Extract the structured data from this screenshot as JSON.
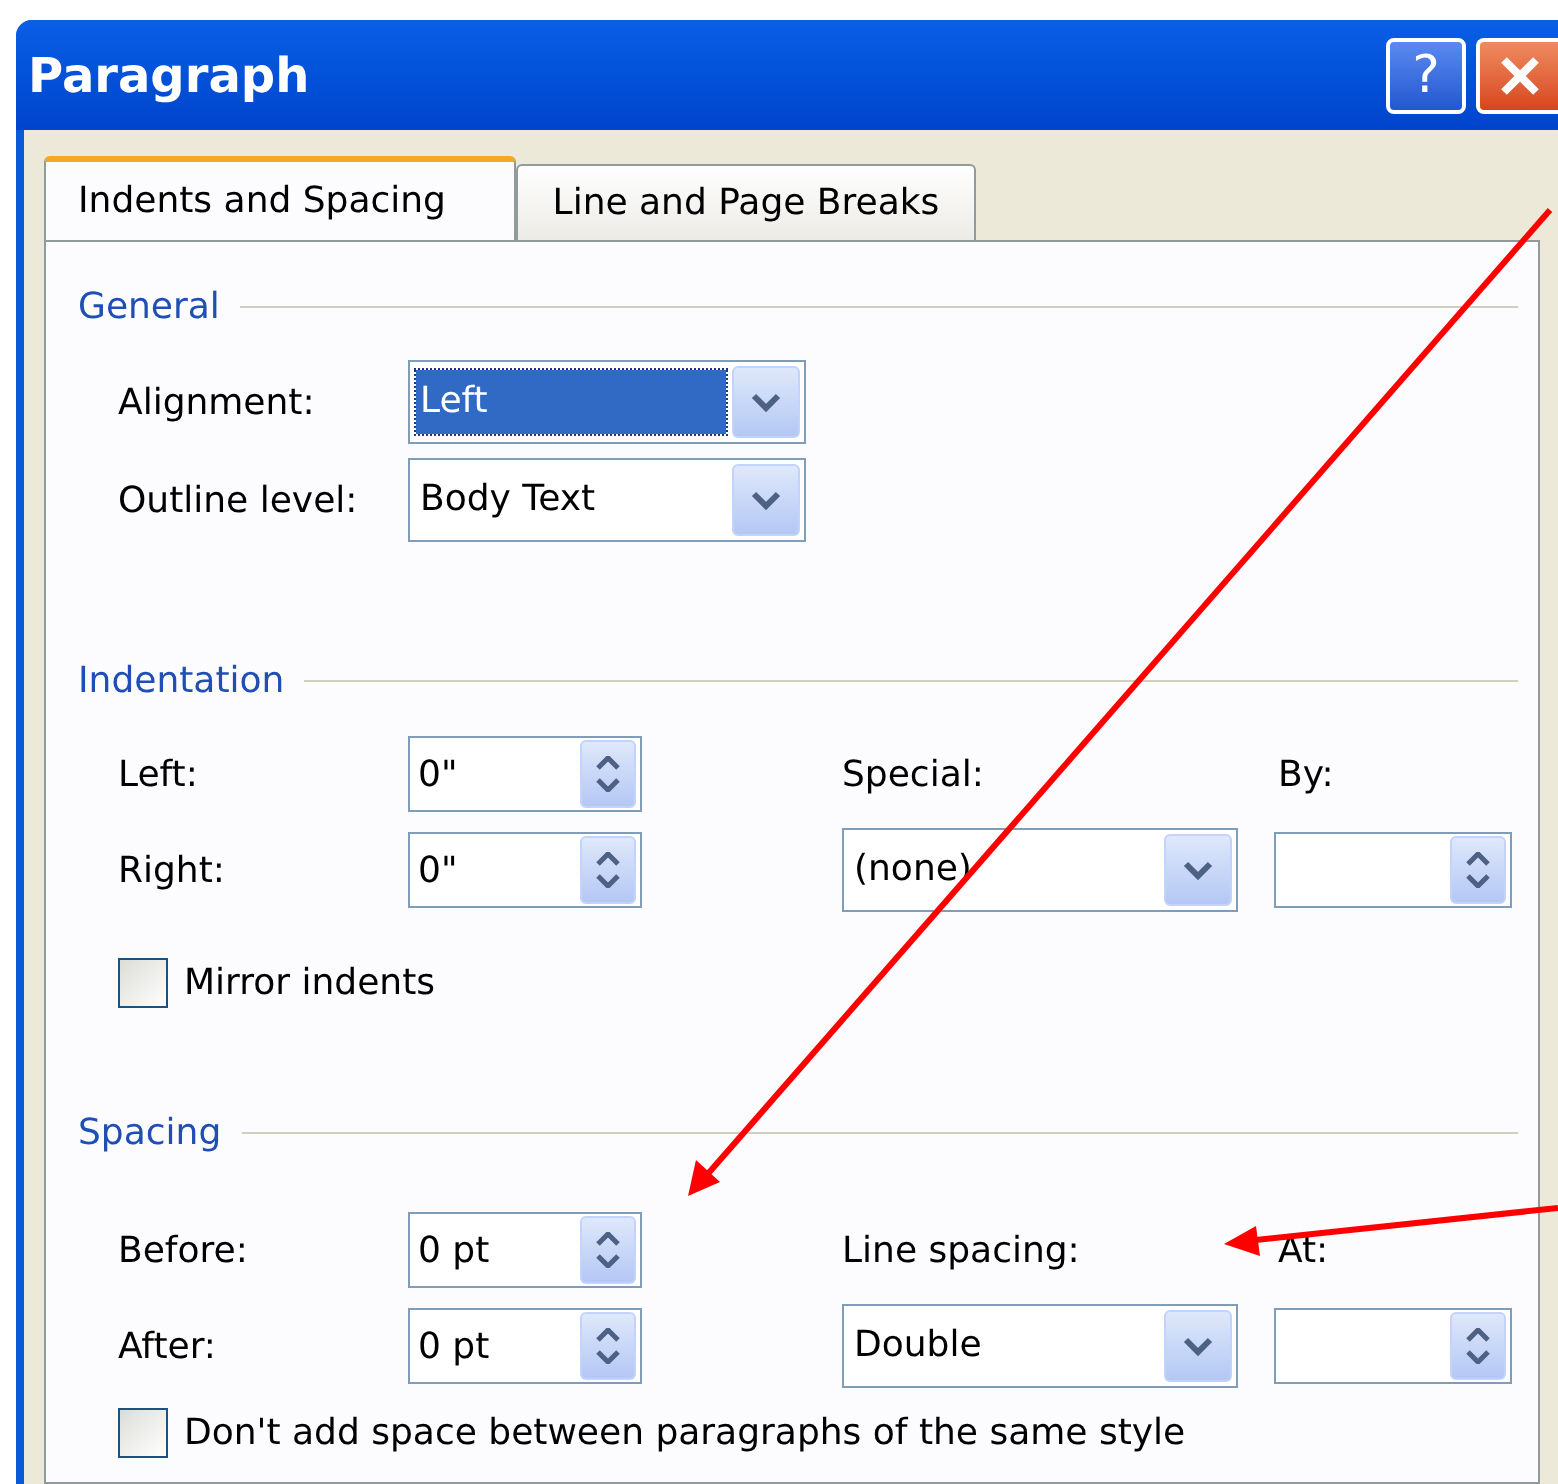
{
  "window": {
    "title": "Paragraph",
    "help": "?"
  },
  "tabs": [
    {
      "label": "Indents and Spacing",
      "selected": true
    },
    {
      "label": "Line and Page Breaks",
      "selected": false
    }
  ],
  "general": {
    "title": "General",
    "fields": [
      {
        "label": "Alignment:",
        "value": "Left",
        "focused": true
      },
      {
        "label": "Outline level:",
        "value": "Body Text",
        "focused": false
      }
    ]
  },
  "indentation": {
    "title": "Indentation",
    "left": {
      "label": "Left:",
      "value": "0\""
    },
    "right": {
      "label": "Right:",
      "value": "0\""
    },
    "special": {
      "label": "Special:",
      "value": "(none)"
    },
    "by": {
      "label": "By:"
    },
    "mirror_indents": {
      "label": "Mirror indents",
      "checked": false
    }
  },
  "spacing": {
    "title": "Spacing",
    "before": {
      "label": "Before:",
      "value": "0 pt"
    },
    "after": {
      "label": "After:",
      "value": "0 pt"
    },
    "line_spacing": {
      "label": "Line spacing:",
      "value": "Double"
    },
    "at": {
      "label": "At:"
    },
    "dont_add_space": {
      "label": "Don't add space between paragraphs of the same style",
      "checked": false
    }
  }
}
